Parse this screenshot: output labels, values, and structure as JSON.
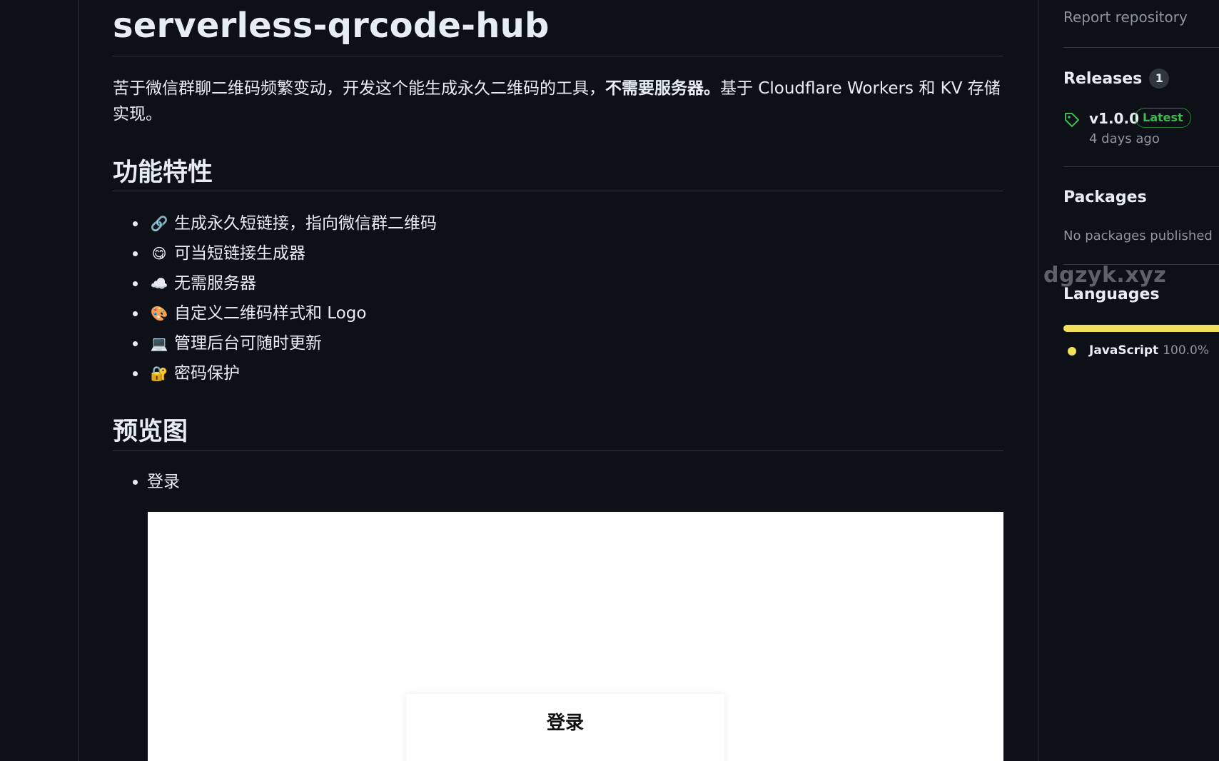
{
  "repo": {
    "title": "serverless-qrcode-hub"
  },
  "readme": {
    "description_prefix": "苦于微信群聊二维码频繁变动，开发这个能生成永久二维码的工具，",
    "description_bold": "不需要服务器。",
    "description_suffix": "基于 Cloudflare Workers 和 KV 存储实现。",
    "features_heading": "功能特性",
    "features": [
      {
        "emoji": "🔗",
        "icon": "link-icon",
        "text": "生成永久短链接，指向微信群二维码"
      },
      {
        "emoji": "😋",
        "icon": "yum-face-icon",
        "text": "可当短链接生成器"
      },
      {
        "emoji": "☁️",
        "icon": "cloud-icon",
        "text": "无需服务器"
      },
      {
        "emoji": "🎨",
        "icon": "palette-icon",
        "text": "自定义二维码样式和 Logo"
      },
      {
        "emoji": "💻",
        "icon": "laptop-icon",
        "text": "管理后台可随时更新"
      },
      {
        "emoji": "🔐",
        "icon": "lock-icon",
        "text": "密码保护"
      }
    ],
    "preview_heading": "预览图",
    "preview_item": "登录",
    "preview_image": {
      "login_title": "登录"
    }
  },
  "sidebar": {
    "report_link": "Report repository",
    "releases": {
      "heading": "Releases",
      "count": "1",
      "latest_name": "v1.0.0",
      "latest_badge": "Latest",
      "latest_date": "4 days ago"
    },
    "packages": {
      "heading": "Packages",
      "empty_text": "No packages published"
    },
    "languages": {
      "heading": "Languages",
      "items": [
        {
          "name": "JavaScript",
          "percent": "100.0%",
          "fraction": 1.0,
          "color": "#f1e05a"
        }
      ]
    }
  },
  "watermark": "dgzyk.xyz",
  "colors": {
    "background": "#0d1117",
    "border": "#30363d",
    "text": "#e6edf3",
    "muted": "#8d96a0",
    "latest_green": "#3fb950",
    "tag_icon_green": "#3fb950"
  }
}
